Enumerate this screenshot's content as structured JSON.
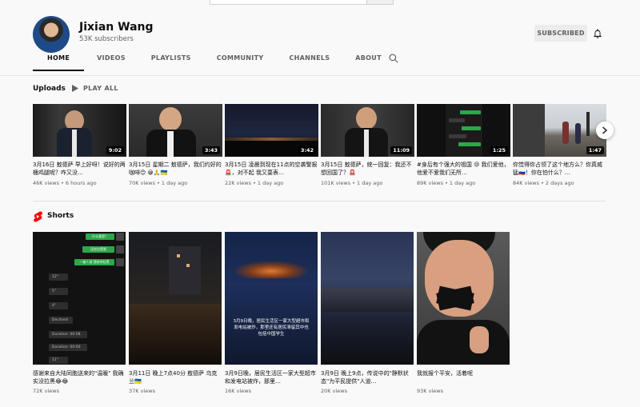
{
  "channel": {
    "name": "Jixian Wang",
    "subscribers": "53K subscribers",
    "subscribe_label": "SUBSCRIBED"
  },
  "tabs": [
    {
      "label": "HOME",
      "active": true
    },
    {
      "label": "VIDEOS"
    },
    {
      "label": "PLAYLISTS"
    },
    {
      "label": "COMMUNITY"
    },
    {
      "label": "CHANNELS"
    },
    {
      "label": "ABOUT"
    }
  ],
  "uploads": {
    "title": "Uploads",
    "play_all": "PLAY ALL",
    "videos": [
      {
        "title": "3月16日 敖德萨 早上好呀！说好的两桶鸡腿呢？咋又没…",
        "meta": "46K views • 6 hours ago",
        "duration": "9:02"
      },
      {
        "title": "3月15日 星期二 敖德萨，我们约好的咖啡😊 😀🙏🇺🇦",
        "meta": "70K views • 1 day ago",
        "duration": "3:43"
      },
      {
        "title": "3月15日 凌晨到现在11点的空袭警报🚨，对不起 我又耍表…",
        "meta": "22K views • 1 day ago",
        "duration": "3:42"
      },
      {
        "title": "3月15日 敖德萨，统一回复：我还不想回国了？🚨",
        "meta": "101K views • 1 day ago",
        "duration": "11:09"
      },
      {
        "title": "#身后有个强大的祖国 😢 我们爱他，他爱不爱我们无所…",
        "meta": "89K views • 1 day ago",
        "duration": "1:25"
      },
      {
        "title": "你觉得你占领了这个地方么？你真威猛🇷🇺！你在怕什么？…",
        "meta": "84K views • 2 days ago",
        "duration": "1:47"
      }
    ]
  },
  "shorts": {
    "title": "Shorts",
    "items": [
      {
        "title": "感谢来自大陆同胞送来的\"温暖\" 我确实没拉黑😂😂",
        "meta": "72K views"
      },
      {
        "title": "3月11日 晚上7点40分 敖德萨 乌克兰🇺🇦",
        "meta": "37K views"
      },
      {
        "title": "3月9日晚，居民生活区一家大型超市和发电站被炸，那里…",
        "meta": "16K views",
        "overlay": "3月9日晚，居民生活区一家大型超市和发电站被炸，那里还有居民滞留其中也包括中国学生"
      },
      {
        "title": "3月9日 晚上9点，传说中的\"静默状态\"为平民提供\"人道…",
        "meta": "20K views"
      },
      {
        "title": "我就报个平安，活着呢",
        "meta": "93K views"
      }
    ]
  },
  "chat_snippets": {
    "msg1": "什么意思？",
    "msg2": "还在拉黑呢",
    "msg3": "一被人说 我给你拉黑",
    "c1": "12\"",
    "c2": "5\"",
    "c3": "4\"",
    "c4": "Declined",
    "c5": "Duration: 00:08",
    "c6": "Duration: 00:00",
    "c7": "11\""
  },
  "colors": {
    "background": "#f9f9f9",
    "shorts_red": "#ff0000",
    "subscribed_bg": "#ececec",
    "chat_green": "#2aa84a"
  }
}
